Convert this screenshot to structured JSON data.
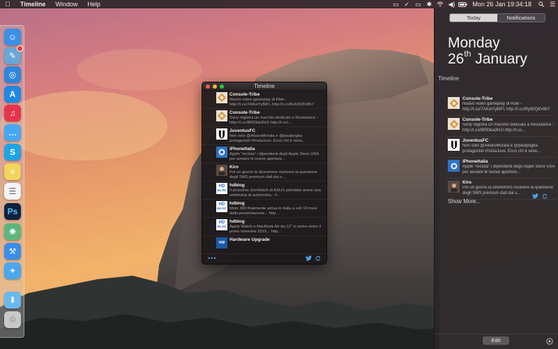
{
  "menubar": {
    "app_name": "Timeline",
    "menus": [
      "Window",
      "Help"
    ],
    "clock": "Mon 26 Jan  19:34:18"
  },
  "dock": {
    "items": [
      {
        "name": "finder",
        "glyph": "☺",
        "color": "#3b8fe6"
      },
      {
        "name": "preview",
        "glyph": "✎",
        "color": "#6aa6d8",
        "badge": true
      },
      {
        "name": "safari",
        "glyph": "◎",
        "color": "#2f86d9"
      },
      {
        "name": "app-store",
        "glyph": "A",
        "color": "#1e88e5"
      },
      {
        "name": "itunes",
        "glyph": "♫",
        "color": "#e8344a"
      },
      {
        "name": "messages",
        "glyph": "…",
        "color": "#47a7f5"
      },
      {
        "name": "skype",
        "glyph": "S",
        "color": "#1fa3e8"
      },
      {
        "name": "notes",
        "glyph": "≡",
        "color": "#f1d45a"
      },
      {
        "name": "reminders",
        "glyph": "☰",
        "color": "#f4f4f4"
      },
      {
        "name": "photoshop",
        "glyph": "Ps",
        "color": "#0f2240"
      },
      {
        "name": "atom",
        "glyph": "✺",
        "color": "#5fb67d"
      },
      {
        "name": "xcode",
        "glyph": "⚒",
        "color": "#3a8ee8"
      },
      {
        "name": "tweetbot",
        "glyph": "✦",
        "color": "#49a8f0"
      },
      {
        "name": "downloads-folder",
        "glyph": "⬇",
        "color": "#69b9ec"
      },
      {
        "name": "trash",
        "glyph": "♲",
        "color": "#c9c9c9"
      }
    ]
  },
  "timeline_window": {
    "title": "Timeline",
    "tweets": [
      {
        "name": "Console-Tribe",
        "text": "Nuovo video gameplay di Ride - http://t.co/7AKwYyBIFL http://t.co/Ry60Q6V8h7",
        "avatar": "console"
      },
      {
        "name": "Console-Tribe",
        "text": "Sony registra un marchio dedicato a Resistance - http://t.co/BRDkia3HJI http://t.co/...",
        "avatar": "console"
      },
      {
        "name": "JuventusFC",
        "text": "Non solo @AlvaroMorata e @paulpogba protagonisti #InstaJuve. Ecco chi è venu...",
        "avatar": "juve"
      },
      {
        "name": "iPhoneItalia",
        "text": "Apple \"recluta\" i dipendenti degli Apple Store USA per avviare le nuove aperture...",
        "avatar": "iphone"
      },
      {
        "name": "Kiro",
        "text": "Poi un giorno la dovremmo risolvere la questione degli SMS premium dati dai s...",
        "avatar": "kiro"
      },
      {
        "name": "hdblog",
        "text": "Il prossimo ZenWatch di ASUS potrebbe avere una settimana di autonomia - h...",
        "avatar": "hd"
      },
      {
        "name": "hdblog",
        "text": "Moto 360 finalmente arriva in Italia a soli 10 mesi dalla presentazione... http...",
        "avatar": "hd"
      },
      {
        "name": "hdblog",
        "text": "Apple Watch e MacBook Air da 12\" in arrivo entro il primo trimestre 2015... http...",
        "avatar": "hd"
      },
      {
        "name": "Hardware Upgrade",
        "text": "",
        "avatar": "hwu"
      }
    ],
    "more_label": "•••"
  },
  "notification_center": {
    "tabs": {
      "today": "Today",
      "notifications": "Notifications"
    },
    "day": "Monday",
    "date_number": "26",
    "date_suffix": "th",
    "date_month": "January",
    "section_title": "Timeline",
    "tweets": [
      {
        "name": "Console-Tribe",
        "text": "Nuovo video gameplay di Ride - http://t.co/7AKwYyBIFL http://t.co/Ry60Q6V8h7",
        "avatar": "console"
      },
      {
        "name": "Console-Tribe",
        "text": "Sony registra un marchio dedicato a Resistance - http://t.co/BRDkia3HJI http://t.co...",
        "avatar": "console"
      },
      {
        "name": "JuventusFC",
        "text": "Non solo @AlvaroMorata e @paulpogba protagonisti #InstaJuve. Ecco chi è venu...",
        "avatar": "juve"
      },
      {
        "name": "iPhoneItalia",
        "text": "Apple \"recluta\" i dipendenti degli Apple Store USA per avviare le nuove aperture...",
        "avatar": "iphone"
      },
      {
        "name": "Kiro",
        "text": "Poi un giorno la dovremmo risolvere la questione degli SMS premium dati dai s...",
        "avatar": "kiro"
      }
    ],
    "show_more": "Show More...",
    "edit_label": "Edit"
  },
  "colors": {
    "twitter_blue": "#4ba3e8",
    "close": "#fc5f57",
    "minimize": "#fdbb2e",
    "zoom": "#28c840"
  }
}
